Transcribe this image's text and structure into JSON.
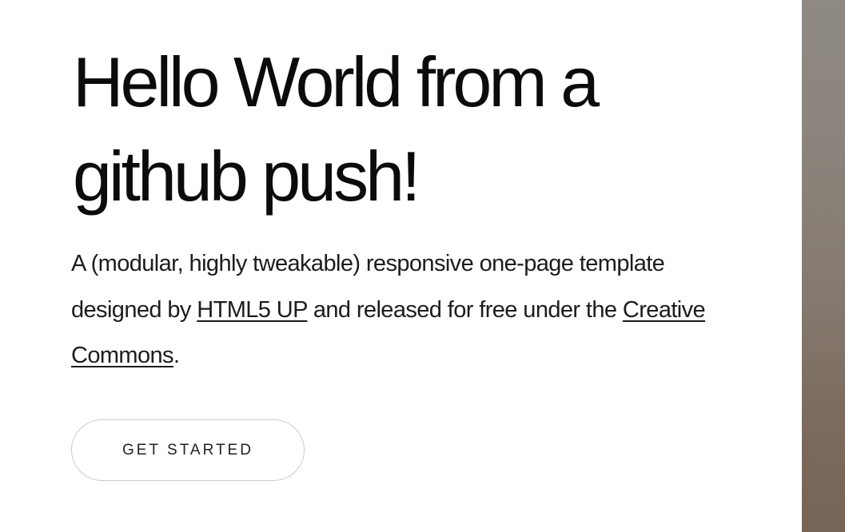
{
  "hero": {
    "title_line1": "Hello World from a",
    "title_line2": "github push!"
  },
  "description": {
    "part1": "A (modular, highly tweakable) responsive one-page template designed by ",
    "link1": "HTML5 UP",
    "part2": " and released for free under the ",
    "link2": "Creative Commons",
    "part3": "."
  },
  "cta": {
    "label": "GET STARTED"
  },
  "colors": {
    "text": "#111111",
    "button_border": "#c9c9c9",
    "side_image": "#857a70"
  }
}
